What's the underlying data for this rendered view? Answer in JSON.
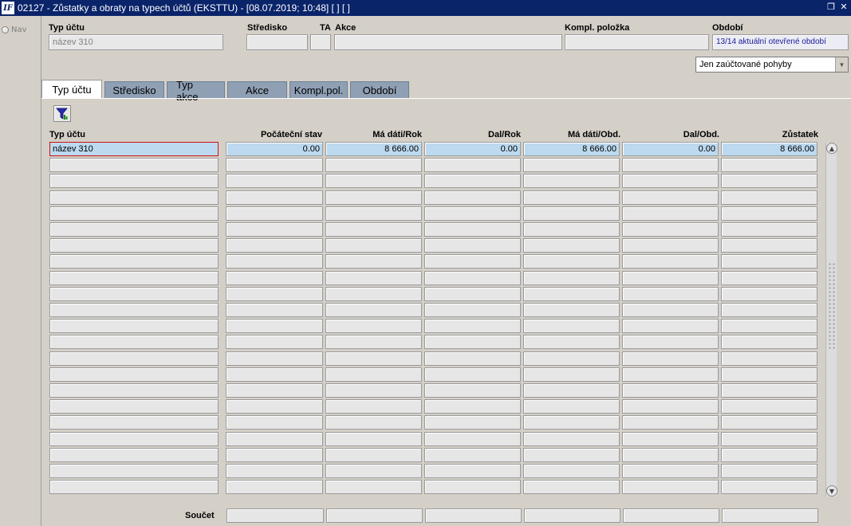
{
  "window": {
    "title": "02127 - Zůstatky a obraty na typech účtů (EKSTTU) - [08.07.2019; 10:48]  [ ]  [ ]",
    "icon_label": "IF"
  },
  "nav": {
    "label": "Nav"
  },
  "header": {
    "typ_uctu_label": "Typ účtu",
    "typ_uctu_value": "název 310",
    "stredisko_label": "Středisko",
    "stredisko_value": "",
    "ta_label": "TA",
    "ta_value": "",
    "akce_label": "Akce",
    "akce_value": "",
    "kompl_label": "Kompl. položka",
    "kompl_value": "",
    "obdobi_label": "Období",
    "obdobi_value": "13/14 aktuální otevřené období"
  },
  "filter_select": {
    "value": "Jen zaúčtované pohyby"
  },
  "tabs": [
    {
      "label": "Typ účtu",
      "active": true
    },
    {
      "label": "Středisko",
      "active": false
    },
    {
      "label": "Typ akce",
      "active": false
    },
    {
      "label": "Akce",
      "active": false
    },
    {
      "label": "Kompl.pol.",
      "active": false
    },
    {
      "label": "Období",
      "active": false
    }
  ],
  "table": {
    "columns": [
      "Typ účtu",
      "Počáteční stav",
      "Má dáti/Rok",
      "Dal/Rok",
      "Má dáti/Obd.",
      "Dal/Obd.",
      "Zůstatek"
    ],
    "rows": [
      [
        "název 310",
        "0.00",
        "8 666.00",
        "0.00",
        "8 666.00",
        "0.00",
        "8 666.00"
      ]
    ],
    "empty_rows": 21
  },
  "footer": {
    "sum_label": "Součet"
  }
}
